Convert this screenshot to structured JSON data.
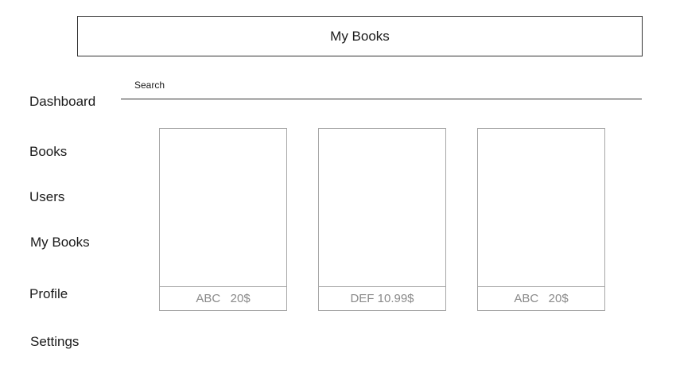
{
  "header": {
    "title": "My Books"
  },
  "sidebar": {
    "items": [
      {
        "label": "Dashboard"
      },
      {
        "label": "Books"
      },
      {
        "label": "Users"
      },
      {
        "label": "My Books"
      },
      {
        "label": "Profile"
      },
      {
        "label": "Settings"
      }
    ]
  },
  "search": {
    "placeholder": "Search",
    "value": ""
  },
  "books": [
    {
      "caption": "ABC   20$"
    },
    {
      "caption": "DEF 10.99$"
    },
    {
      "caption": "ABC   20$"
    }
  ]
}
